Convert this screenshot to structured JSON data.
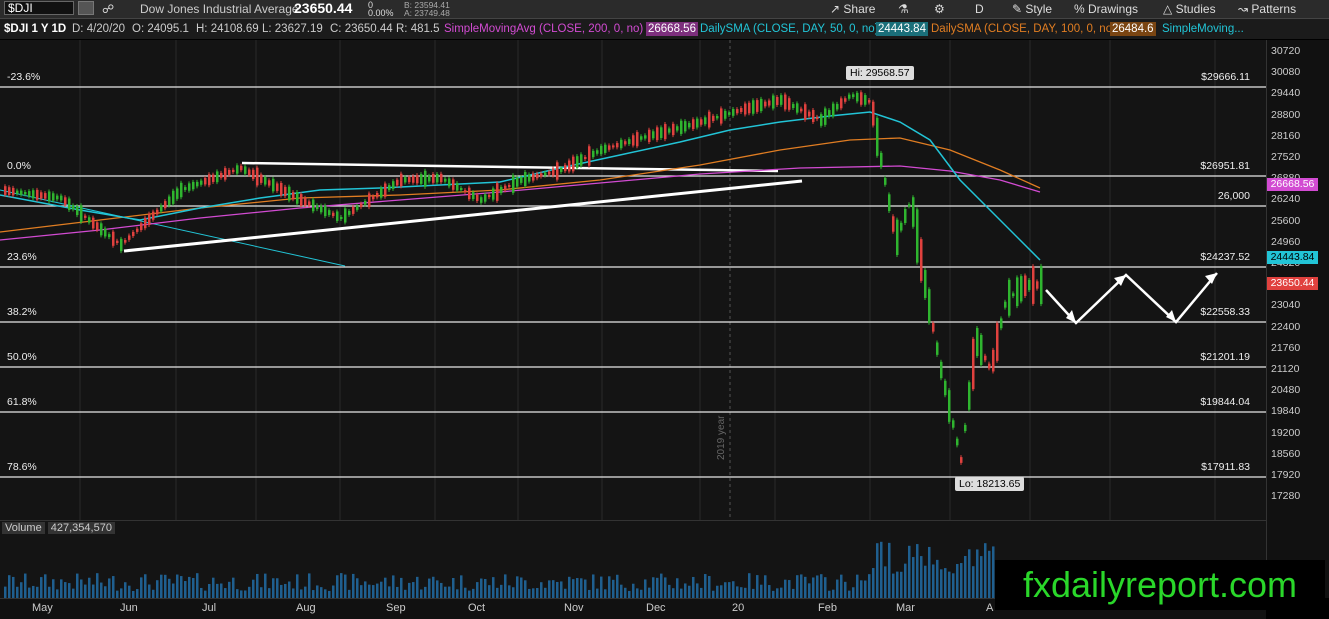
{
  "toolbar": {
    "symbol": "$DJI",
    "description": "Dow Jones Industrial Average",
    "last": "23650.44",
    "change": "0",
    "change_pct": "0.00%",
    "bid": "B: 23594.41",
    "ask": "A: 23749.48",
    "share": "Share",
    "period": "D",
    "style": "Style",
    "drawings": "Drawings",
    "studies": "Studies",
    "patterns": "Patterns"
  },
  "info": {
    "chart_label": "$DJI 1 Y 1D",
    "date": "D: 4/20/20",
    "open": "O: 24095.1",
    "high": "H: 24108.69",
    "low": "L: 23627.19",
    "close": "C: 23650.44",
    "range": "R: 481.5",
    "sma200_label": "SimpleMovingAvg (CLOSE, 200, 0, no)",
    "sma200_value": "26668.56",
    "sma50_label": "DailySMA (CLOSE, DAY, 50, 0, no)",
    "sma50_value": "24443.84",
    "sma100_label": "DailySMA (CLOSE, DAY, 100, 0, no)",
    "sma100_value": "26484.6",
    "more": "SimpleMoving..."
  },
  "colors": {
    "sma200": "#d24bd2",
    "sma50": "#22c4d6",
    "sma100": "#e07d22",
    "up": "#2fb52f",
    "down": "#e0413e",
    "brand": "#2ad72a"
  },
  "price_axis": [
    "30720",
    "30080",
    "29440",
    "28800",
    "28160",
    "27520",
    "26880",
    "26240",
    "25600",
    "24960",
    "24320",
    "23680",
    "23040",
    "22400",
    "21760",
    "21120",
    "20480",
    "19840",
    "19200",
    "18560",
    "17920",
    "17280"
  ],
  "price_tags": {
    "sma200": "26668.56",
    "sma50": "24443.84",
    "last": "23650.44"
  },
  "fib_levels": [
    {
      "pct": "-23.6%",
      "price": "$29666.11"
    },
    {
      "pct": "0.0%",
      "price": "$26951.81"
    },
    {
      "pct": "",
      "price": "26,000"
    },
    {
      "pct": "23.6%",
      "price": "$24237.52"
    },
    {
      "pct": "38.2%",
      "price": "$22558.33"
    },
    {
      "pct": "50.0%",
      "price": "$21201.19"
    },
    {
      "pct": "61.8%",
      "price": "$19844.04"
    },
    {
      "pct": "78.6%",
      "price": "$17911.83"
    }
  ],
  "annotations": {
    "high": "Hi: 29568.57",
    "low": "Lo: 18213.65",
    "year": "2019 year"
  },
  "volume": {
    "label": "Volume",
    "value": "427,354,570"
  },
  "months": [
    "May",
    "Jun",
    "Jul",
    "Aug",
    "Sep",
    "Oct",
    "Nov",
    "Dec",
    "20",
    "Feb",
    "Mar",
    "A"
  ],
  "brand": "fxdailyreport.com"
}
